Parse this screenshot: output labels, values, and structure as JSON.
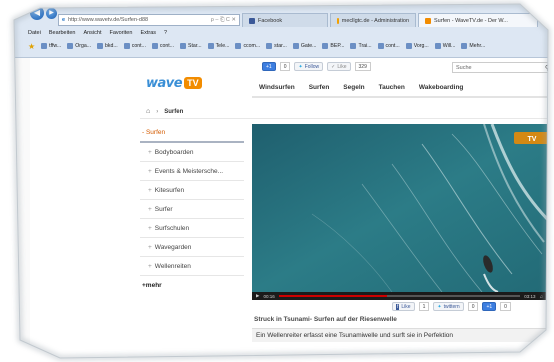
{
  "browser": {
    "url": "http://www.wavetv.de/Surfen-d88",
    "url_icons": "ρ ‒ ⎗ C ✕",
    "tabs": [
      {
        "label": "Facebook",
        "color": "#3b5998",
        "active": false
      },
      {
        "label": "mecllgtc.de - Administration",
        "color": "#f2a000",
        "active": false
      },
      {
        "label": "Surfen - WaveTV.de - Der W...",
        "color": "#f28c00",
        "active": true
      }
    ],
    "menu": [
      "Datei",
      "Bearbeiten",
      "Ansicht",
      "Favoriten",
      "Extras",
      "?"
    ],
    "favorites": [
      "tffw...",
      "Orga...",
      "bkd...",
      "cont...",
      "cont...",
      "Star...",
      "Tele...",
      "ccom...",
      "star...",
      "Gate...",
      "BEP...",
      "Trai...",
      "cont...",
      "Vorg...",
      "Will...",
      "Mehr..."
    ]
  },
  "site": {
    "logo_text": "wave",
    "logo_badge": "TV",
    "social": {
      "gplus_label": "+1",
      "gplus_count": "0",
      "twitter_label": "Follow",
      "like_label": "Like",
      "like_count": "329"
    },
    "search_placeholder": "Suche",
    "nav": [
      "Windsurfen",
      "Surfen",
      "Segeln",
      "Tauchen",
      "Wakeboarding"
    ],
    "breadcrumb_current": "Surfen",
    "sidebar": {
      "header": "- Surfen",
      "items": [
        "Bodyboarden",
        "Events & Meistersche...",
        "Kitesurfen",
        "Surfer",
        "Surfschulen",
        "Wavegarden",
        "Wellenreiten"
      ],
      "more": "mehr"
    },
    "video": {
      "time_current": "00:16",
      "time_total": "03:13",
      "progress": 0.45,
      "title": "Struck in Tsunami- Surfen auf der Riesenwelle",
      "description": "Ein Wellenreiter erfasst eine Tsunamiwelle und surft sie in Perfektion",
      "share_like_count": "1",
      "share_tweet_count": "0",
      "share_gplus_count": "0"
    }
  }
}
